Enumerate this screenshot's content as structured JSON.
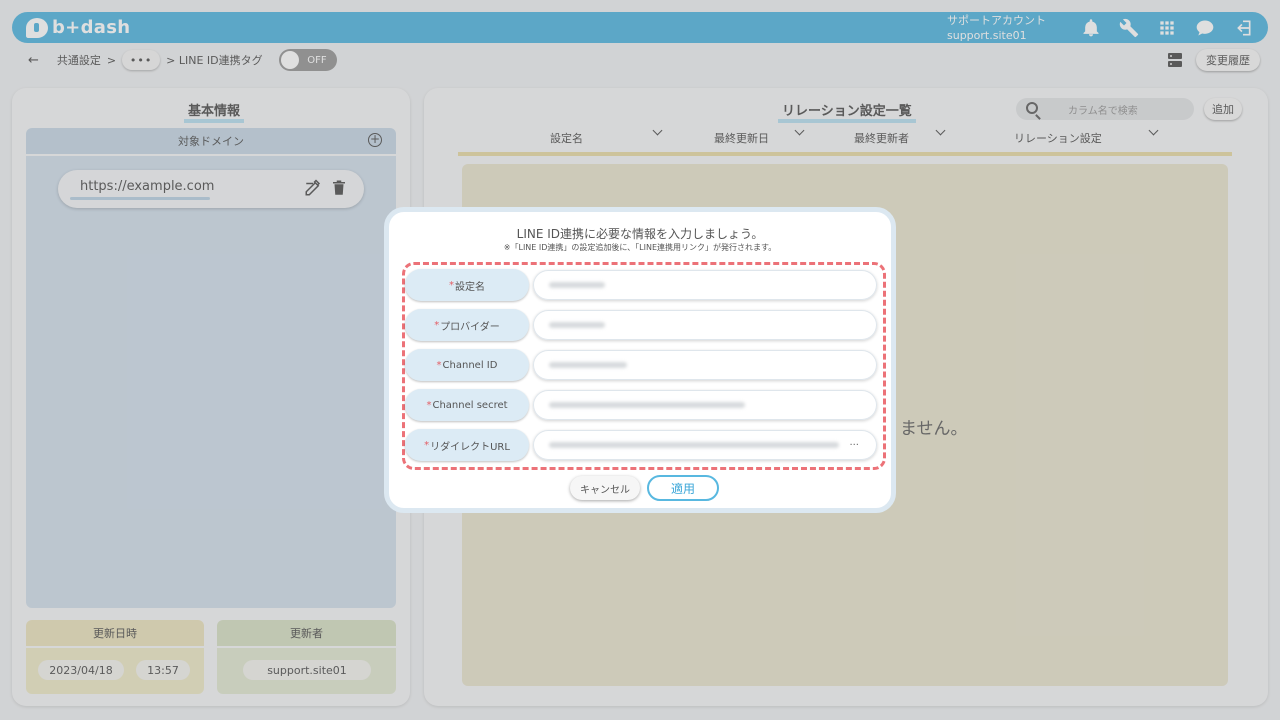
{
  "header": {
    "logo_text": "b+dash",
    "account_line1": "サポートアカウント",
    "account_line2": "support.site01",
    "icons": [
      "bell-icon",
      "wrench-icon",
      "grid-icon",
      "chat-icon",
      "logout-icon"
    ]
  },
  "subbar": {
    "back": "←",
    "crumb1": "共通設定",
    "sep1": ">",
    "dots": "•••",
    "sep2": "> LINE ID連携タグ",
    "toggle_label": "OFF",
    "history_button": "変更履歴"
  },
  "left": {
    "title": "基本情報",
    "domain_header": "対象ドメイン",
    "domains": [
      "https://example.com"
    ],
    "updated_at_header": "更新日時",
    "updated_by_header": "更新者",
    "updated_date": "2023/04/18",
    "updated_time": "13:57",
    "updated_by": "support.site01"
  },
  "right": {
    "title": "リレーション設定一覧",
    "search_placeholder": "カラム名で検索",
    "add_button": "追加",
    "columns": [
      "設定名",
      "最終更新日",
      "最終更新者",
      "リレーション設定"
    ],
    "empty_text_visible": "ません。"
  },
  "modal": {
    "title": "LINE ID連携に必要な情報を入力しましょう。",
    "note": "※「LINE ID連携」の設定追加後に、「LINE連携用リンク」が発行されます。",
    "required_mark": "*",
    "fields": [
      {
        "label": "設定名"
      },
      {
        "label": "プロバイダー"
      },
      {
        "label": "Channel ID"
      },
      {
        "label": "Channel secret"
      },
      {
        "label": "リダイレクトURL",
        "overflow": "..."
      }
    ],
    "cancel_button": "キャンセル",
    "apply_button": "適用"
  },
  "colors": {
    "brand": "#58b8e0",
    "required": "#e35d64",
    "highlight_dash": "#ec7278"
  }
}
